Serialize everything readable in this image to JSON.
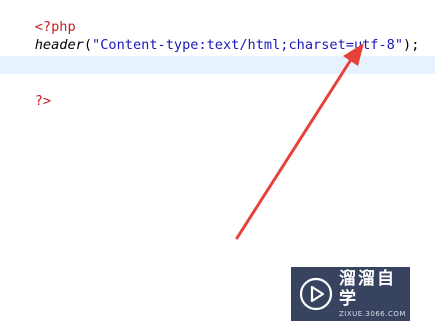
{
  "code": {
    "line1": {
      "open_tag": "<?php"
    },
    "line2": {
      "function": "header",
      "open_paren": "(",
      "string": "\"Content-type:text/html;charset=utf-8\"",
      "close": ");"
    },
    "line4": {
      "close_tag": "?>"
    }
  },
  "annotation": {
    "arrow_color": "#e8413a",
    "arrow_icon": "red-arrow-icon"
  },
  "watermark": {
    "title": "溜溜自学",
    "subtitle": "ZIXUE.3066.COM",
    "logo_icon": "play-logo-icon",
    "background": "#0c1b3c"
  },
  "colors": {
    "php_tag": "#c71d1d",
    "string": "#1a1ab8",
    "current_line_highlight": "#e8f2fe"
  }
}
